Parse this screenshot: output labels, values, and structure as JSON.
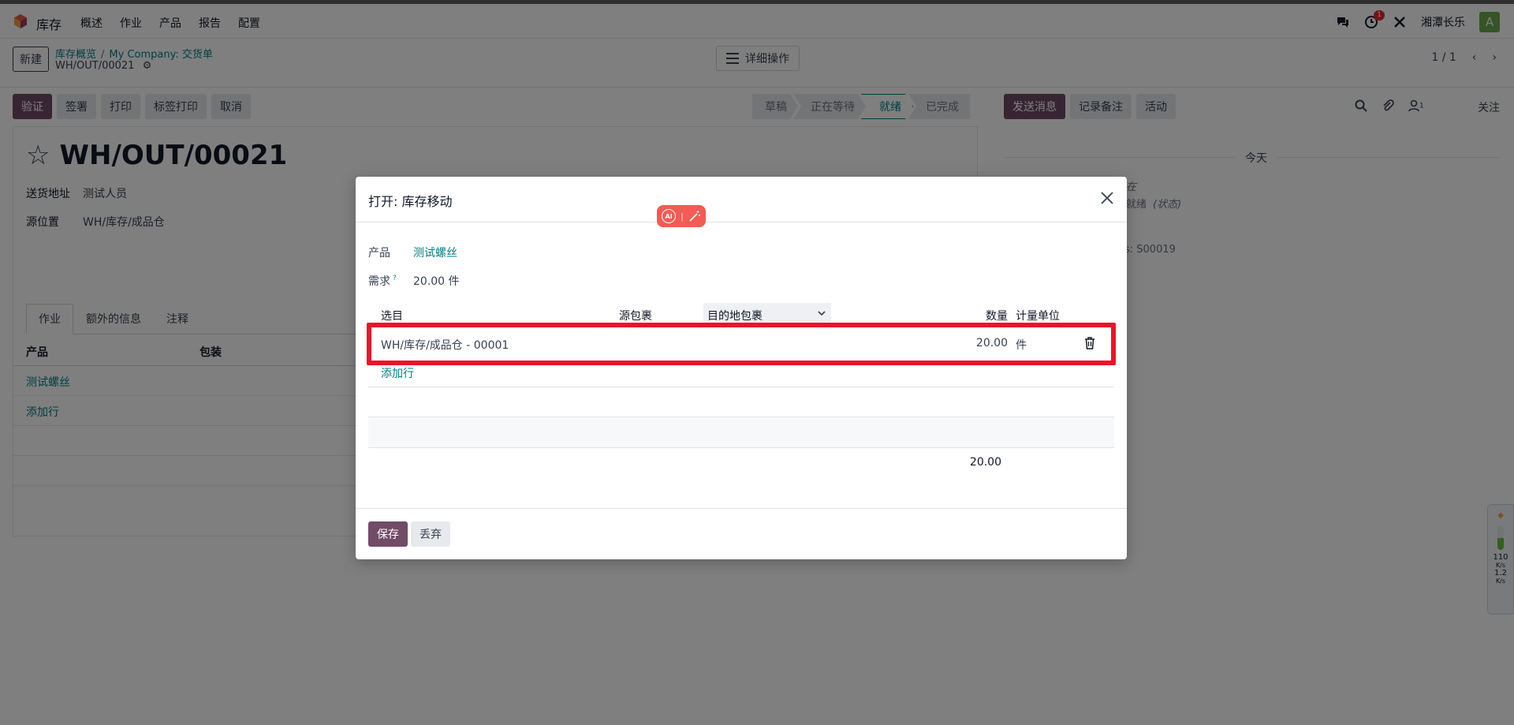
{
  "nav": {
    "app_name": "库存",
    "menu": [
      "概述",
      "作业",
      "产品",
      "报告",
      "配置"
    ],
    "notification_count": "1",
    "user_name": "湘潭长乐",
    "avatar_letter": "A"
  },
  "control": {
    "new_label": "新建",
    "breadcrumb": [
      "库存概览",
      "My Company: 交货单"
    ],
    "record_name": "WH/OUT/00021",
    "actions_label": "详细操作",
    "pager": "1 / 1"
  },
  "statusbar": {
    "buttons": [
      "验证",
      "签署",
      "打印",
      "标签打印",
      "取消"
    ],
    "stages": [
      "草稿",
      "正在等待",
      "就绪",
      "已完成"
    ],
    "active_stage": "就绪"
  },
  "chatter": {
    "buttons": [
      "发送消息",
      "记录备注",
      "活动"
    ],
    "follower_count": "1",
    "follow_label": "关注",
    "today_label": "今天",
    "fragments": [
      "在",
      "就绪",
      "(状态)",
      "s: S00019"
    ]
  },
  "form": {
    "title": "WH/OUT/00021",
    "fields": [
      {
        "label": "送货地址",
        "value": "测试人员"
      },
      {
        "label": "源位置",
        "value": "WH/库存/成品仓"
      }
    ],
    "tabs": [
      "作业",
      "额外的信息",
      "注释"
    ],
    "columns": [
      "产品",
      "包装"
    ],
    "rows": [
      "测试螺丝"
    ],
    "add_line": "添加行"
  },
  "dialog": {
    "title": "打开: 库存移动",
    "product_label": "产品",
    "product_value": "测试螺丝",
    "demand_label": "需求",
    "demand_help": "?",
    "demand_value": "20.00 件",
    "columns": {
      "pick": "选目",
      "source_package": "源包裹",
      "dest_package": "目的地包裹",
      "quantity": "数量",
      "uom": "计量单位"
    },
    "line": {
      "location": "WH/库存/成品仓 - 00001",
      "quantity": "20.00",
      "uom": "件"
    },
    "add_line": "添加行",
    "total": "20.00",
    "save_label": "保存",
    "discard_label": "丢弃",
    "ai_label": "AI"
  },
  "net_widget": {
    "down_value": "110",
    "down_unit": "K/s",
    "up_value": "1.2",
    "up_unit": "K/s"
  },
  "colors": {
    "primary": "#714b67",
    "link": "#017e84",
    "highlight": "#e8142b",
    "ai_badge": "#f25c54"
  }
}
